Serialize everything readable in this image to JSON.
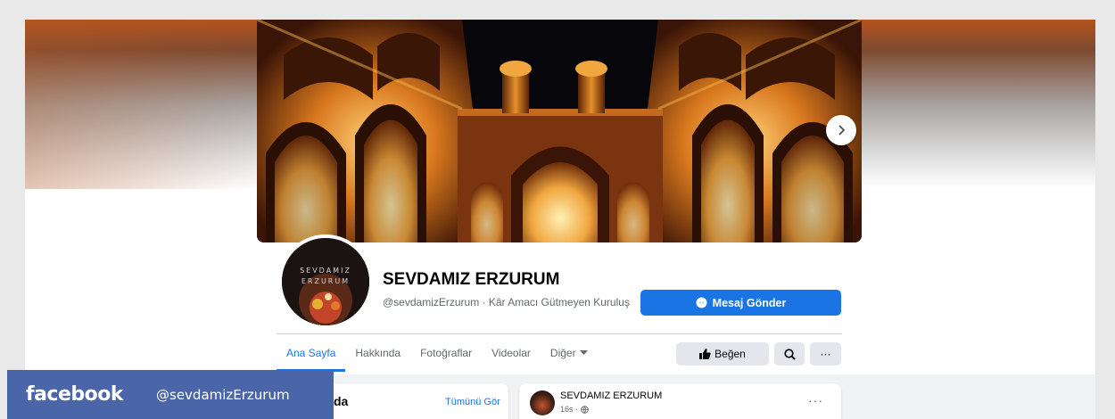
{
  "page": {
    "name": "SEVDAMIZ ERZURUM",
    "subtitle": "@sevdamizErzurum · Kâr Amacı Gütmeyen Kuruluş",
    "avatar_lines": [
      "SEVDAMIZ",
      "ERZURUM"
    ]
  },
  "actions": {
    "message_label": "Mesaj Gönder",
    "like_label": "Beğen",
    "more_label": "···"
  },
  "tabs": [
    {
      "label": "Ana Sayfa",
      "active": true
    },
    {
      "label": "Hakkında",
      "active": false
    },
    {
      "label": "Fotoğraflar",
      "active": false
    },
    {
      "label": "Videolar",
      "active": false
    },
    {
      "label": "Diğer",
      "active": false
    }
  ],
  "left_card": {
    "title_fragment": "da",
    "see_all": "Tümünü Gör"
  },
  "post": {
    "author": "SEVDAMIZ ERZURUM",
    "time": "16s ·",
    "more": "···"
  },
  "brand": {
    "logo": "facebook",
    "handle": "@sevdamizErzurum"
  },
  "icons": {
    "cover_next": "chevron-right-icon",
    "message": "messenger-icon",
    "like": "thumbs-up-icon",
    "search": "search-icon",
    "more_tab": "caret-down-icon",
    "post_privacy": "globe-icon"
  },
  "colors": {
    "accent": "#1b74e4",
    "brand_bar": "#4a65a8",
    "text_primary": "#050505",
    "text_secondary": "#65676b"
  }
}
